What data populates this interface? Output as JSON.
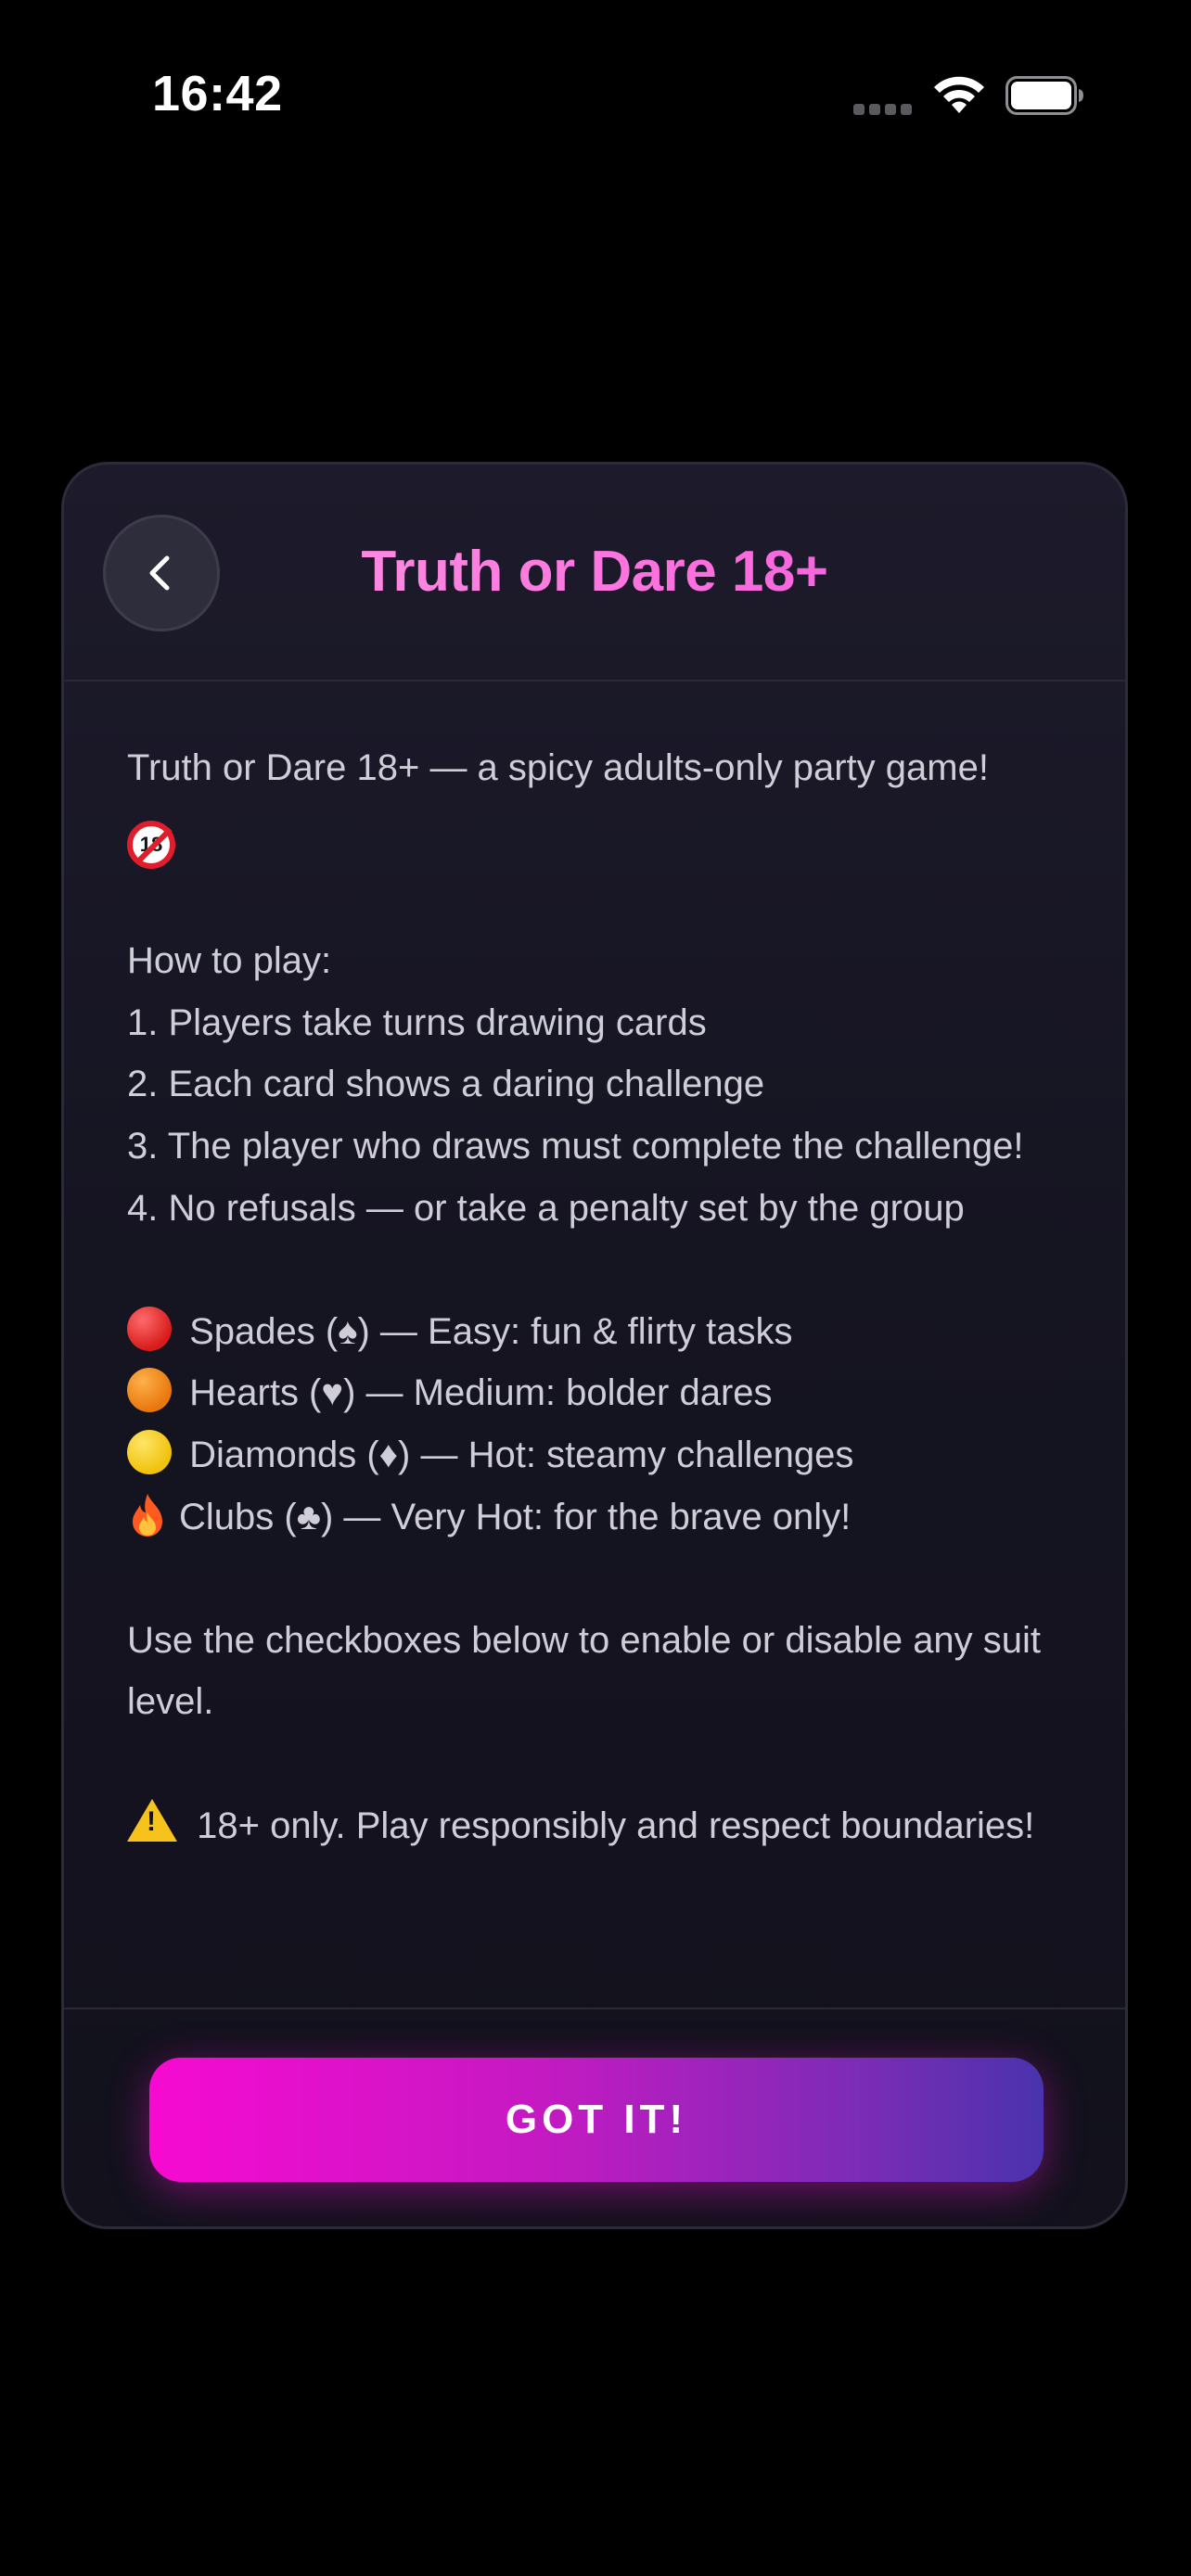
{
  "status_bar": {
    "time": "16:42"
  },
  "header": {
    "title": "Truth or Dare 18+",
    "back_icon": "chevron-left-icon"
  },
  "body": {
    "intro": "Truth or Dare 18+ — a spicy adults-only party game!",
    "intro_icon": "no-under-18-icon",
    "how_to_play_heading": "How to play:",
    "steps": [
      "1. Players take turns drawing cards",
      "2. Each card shows a daring challenge",
      "3. The player who draws must complete the challenge!",
      "4. No refusals — or take a penalty set by the group"
    ],
    "suits": [
      {
        "icon": "red-circle-icon",
        "color": "#e02424",
        "text": "Spades (♠) — Easy: fun & flirty tasks"
      },
      {
        "icon": "orange-circle-icon",
        "color": "#f08a1c",
        "text": "Hearts (♥) — Medium: bolder dares"
      },
      {
        "icon": "yellow-circle-icon",
        "color": "#f5cf1f",
        "text": "Diamonds (♦) — Hot: steamy challenges"
      },
      {
        "icon": "fire-icon",
        "color": "#ff5a1f",
        "text": "Clubs (♣) — Very Hot: for the brave only!"
      }
    ],
    "checkbox_note": "Use the checkboxes below to enable or disable any suit level.",
    "warning_icon": "warning-icon",
    "warning": "18+ only. Play responsibly and respect boundaries!"
  },
  "footer": {
    "button_label": "GOT IT!"
  },
  "colors": {
    "background": "#000000",
    "card": "#171624",
    "title_gradient_start": "#ff9fe3",
    "title_gradient_end": "#f04ee2",
    "button_gradient_start": "#f70ad1",
    "button_gradient_end": "#4a33ad",
    "body_text": "#cfcdd7"
  }
}
